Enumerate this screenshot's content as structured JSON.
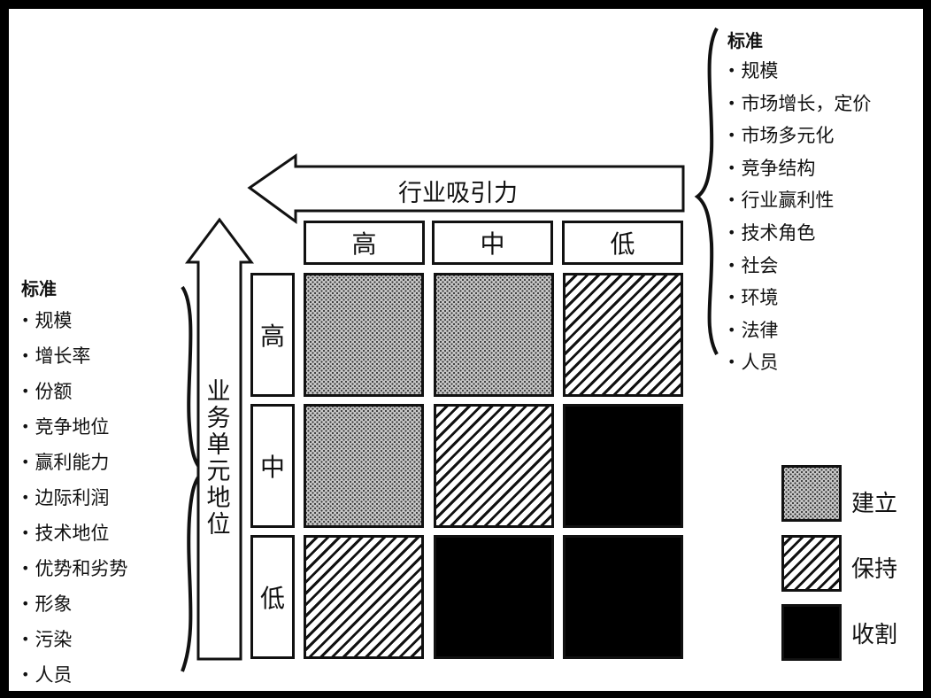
{
  "left_criteria": {
    "title": "标准",
    "items": [
      "规模",
      "增长率",
      "份额",
      "竞争地位",
      "赢利能力",
      "边际利润",
      "技术地位",
      "优势和劣势",
      "形象",
      "污染",
      "人员"
    ]
  },
  "right_criteria": {
    "title": "标准",
    "items": [
      "规模",
      "市场增长，定价",
      "市场多元化",
      "竞争结构",
      "行业赢利性",
      "技术角色",
      "社会",
      "环境",
      "法律",
      "人员"
    ]
  },
  "axes": {
    "horizontal_label": "行业吸引力",
    "vertical_label": "业务单元地位",
    "column_labels": [
      "高",
      "中",
      "低"
    ],
    "row_labels": [
      "高",
      "中",
      "低"
    ]
  },
  "grid": {
    "rows": [
      [
        "build",
        "build",
        "hold"
      ],
      [
        "build",
        "hold",
        "harvest"
      ],
      [
        "hold",
        "harvest",
        "harvest"
      ]
    ]
  },
  "legend": [
    {
      "key": "build",
      "label": "建立"
    },
    {
      "key": "hold",
      "label": "保持"
    },
    {
      "key": "harvest",
      "label": "收割"
    }
  ]
}
